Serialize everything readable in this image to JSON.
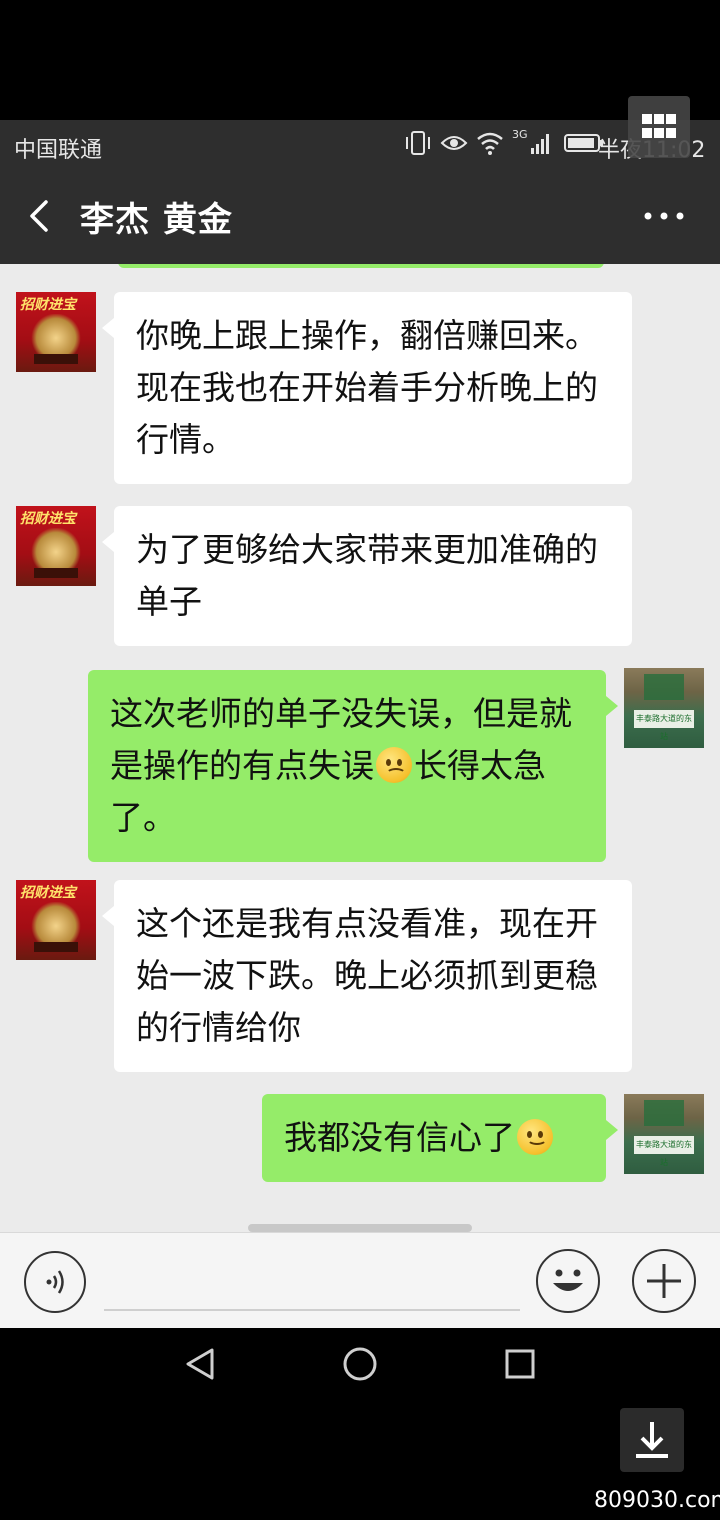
{
  "status_bar": {
    "carrier": "中国联通",
    "network": "3G",
    "time": "半夜11:02"
  },
  "header": {
    "title": "李杰  黄金"
  },
  "messages": [
    {
      "side": "left",
      "text": "你晚上跟上操作，翻倍赚回来。现在我也在开始着手分析晚上的行情。"
    },
    {
      "side": "left",
      "text": "为了更够给大家带来更加准确的单子"
    },
    {
      "side": "right",
      "text_before": "这次老师的单子没失误，但是就是操作的有点失误",
      "emoji": "sad-face",
      "text_after": "长得太急了。"
    },
    {
      "side": "left",
      "text": "这个还是我有点没看准，现在开始一波下跌。晚上必须抓到更稳的行情给你"
    },
    {
      "side": "right",
      "text_before": "我都没有信心了",
      "emoji": "smile-face",
      "text_after": ""
    }
  ],
  "avatars": {
    "left_text": "招财进宝",
    "right_text": "丰泰路大道的东站"
  },
  "watermark": "809030.com",
  "colors": {
    "header_bg": "#2e2e2e",
    "chat_bg": "#ebebeb",
    "bubble_self": "#95ec69",
    "bubble_other": "#ffffff"
  }
}
